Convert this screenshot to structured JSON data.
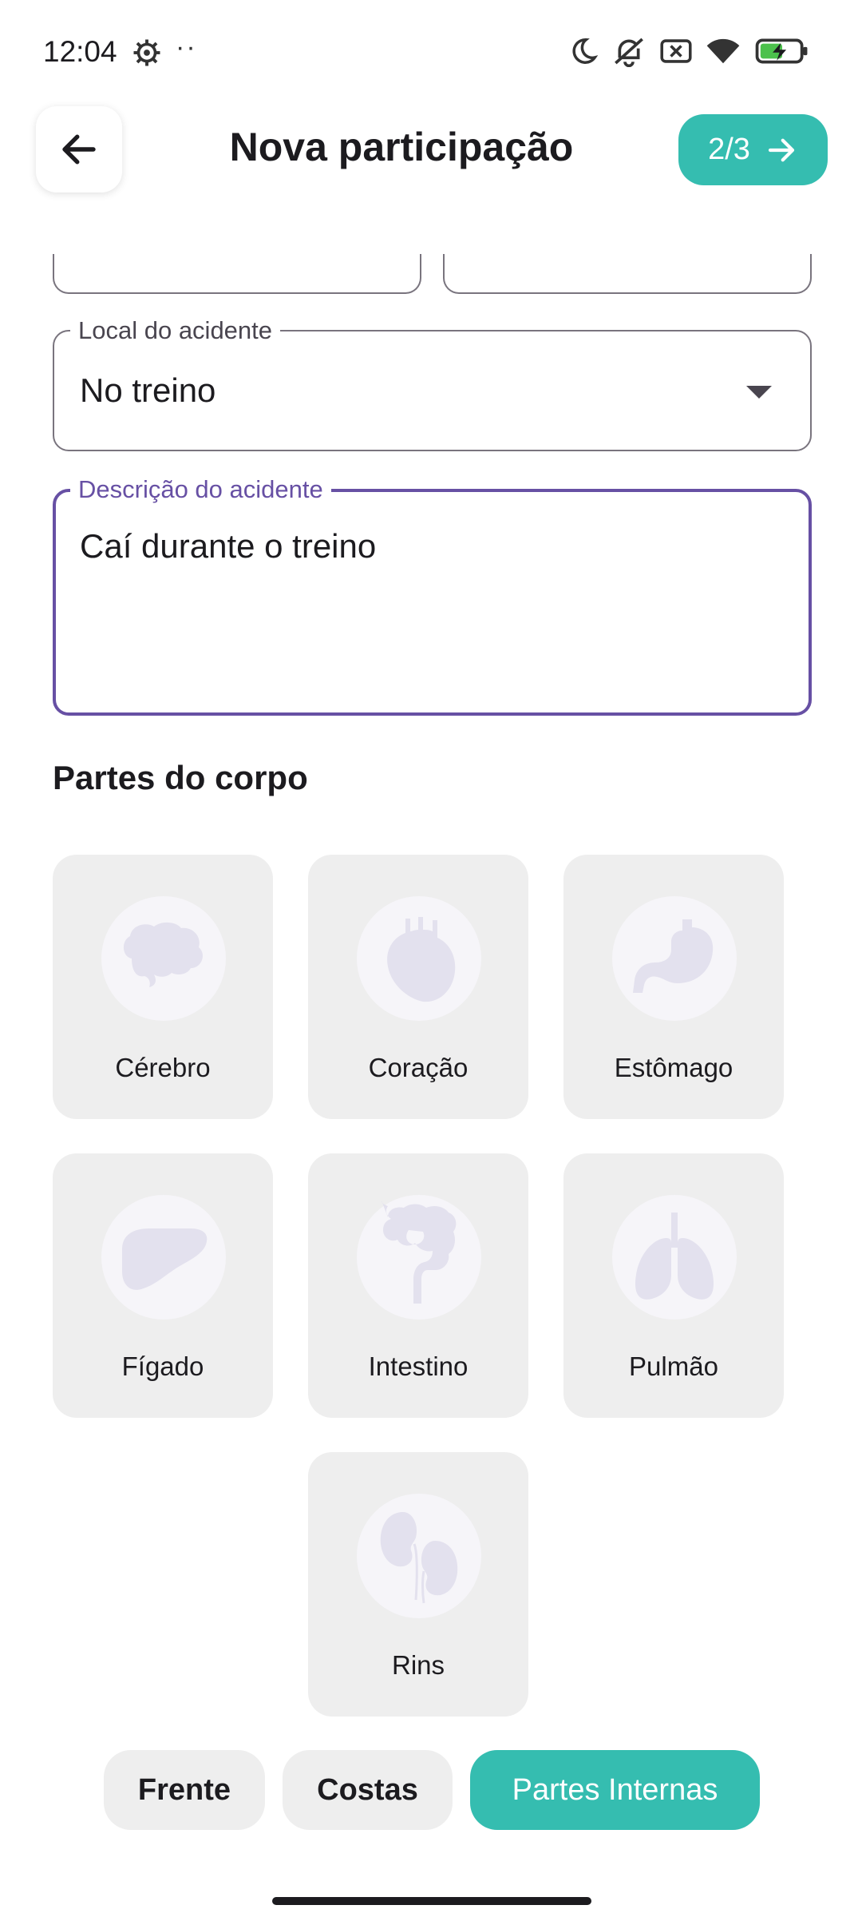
{
  "status_bar": {
    "time": "12:04",
    "dots": "··",
    "icons": [
      "settings-gear-icon",
      "moon-icon",
      "bell-off-icon",
      "no-sim-icon",
      "wifi-icon",
      "battery-charging-icon"
    ]
  },
  "header": {
    "title": "Nova participação",
    "step_label": "2/3"
  },
  "form": {
    "local_label": "Local do acidente",
    "local_value": "No treino",
    "description_label": "Descrição do acidente",
    "description_value": "Caí durante o treino"
  },
  "body_parts": {
    "title": "Partes do corpo",
    "items": [
      {
        "label": "Cérebro",
        "icon": "brain-icon"
      },
      {
        "label": "Coração",
        "icon": "heart-icon"
      },
      {
        "label": "Estômago",
        "icon": "stomach-icon"
      },
      {
        "label": "Fígado",
        "icon": "liver-icon"
      },
      {
        "label": "Intestino",
        "icon": "intestine-icon"
      },
      {
        "label": "Pulmão",
        "icon": "lungs-icon"
      },
      {
        "label": "Rins",
        "icon": "kidneys-icon"
      }
    ]
  },
  "tabs": {
    "front": "Frente",
    "back": "Costas",
    "internal": "Partes Internas",
    "selected": "Partes Internas"
  },
  "colors": {
    "accent": "#35bdb0",
    "focus": "#6750a4",
    "card_bg": "#eeeeee",
    "organ_fill": "#e3e1ee"
  }
}
